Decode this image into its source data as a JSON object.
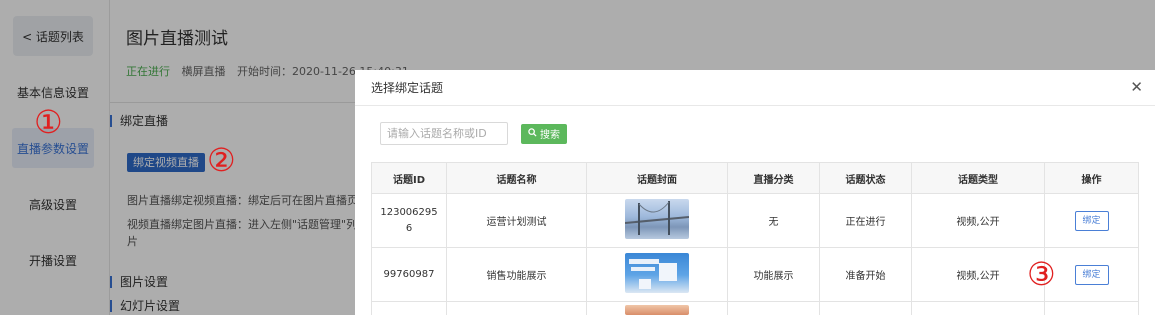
{
  "sidebar": {
    "back_label": "< 话题列表",
    "items": [
      {
        "label": "基本信息设置",
        "active": false
      },
      {
        "label": "直播参数设置",
        "active": true
      },
      {
        "label": "高级设置",
        "active": false
      },
      {
        "label": "开播设置",
        "active": false
      }
    ]
  },
  "main": {
    "title": "图片直播测试",
    "status": "正在进行",
    "mode": "横屏直播",
    "start_time": "开始时间：2020-11-26 15:40:31",
    "section_bind": "绑定直播",
    "bind_button": "绑定视频直播",
    "desc1": "图片直播绑定视频直播：绑定后可在图片直播页",
    "desc2": "视频直播绑定图片直播：进入左侧\"话题管理\"列",
    "desc3": "片",
    "section_image": "图片设置",
    "section_slides": "幻灯片设置"
  },
  "annotations": [
    "①",
    "②",
    "③"
  ],
  "modal": {
    "title": "选择绑定话题",
    "search_placeholder": "请输入话题名称或ID",
    "search_button": "搜索",
    "columns": [
      "话题ID",
      "话题名称",
      "话题封面",
      "直播分类",
      "话题状态",
      "话题类型",
      "操作"
    ],
    "rows": [
      {
        "id": "1230062956",
        "name": "运营计划测试",
        "cover": "bridge-image",
        "category": "无",
        "status": "正在进行",
        "type": "视频,公开",
        "action": "绑定"
      },
      {
        "id": "99760987",
        "name": "销售功能展示",
        "cover": "sales-image",
        "category": "功能展示",
        "status": "准备开始",
        "type": "视频,公开",
        "action": "绑定"
      }
    ]
  },
  "colors": {
    "accent_blue": "#2f6bc9",
    "live_green": "#4caf50",
    "annotation_red": "#e02020",
    "search_green": "#5cb85c"
  }
}
